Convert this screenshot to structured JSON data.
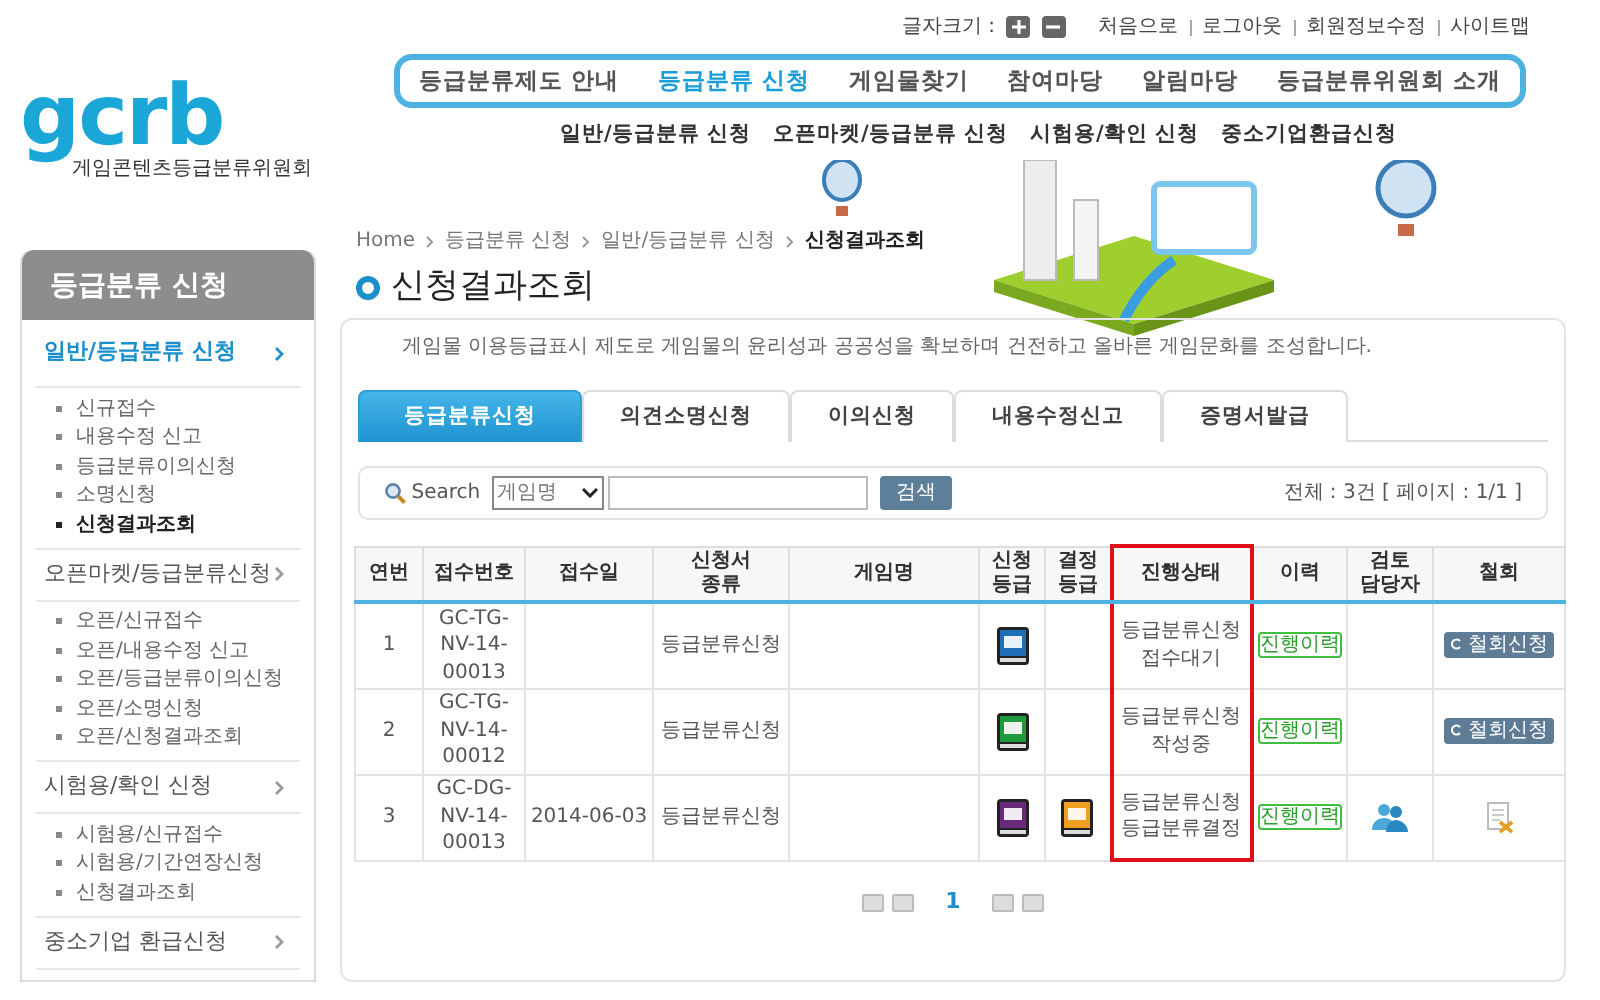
{
  "top_bar": {
    "font_size_label": "글자크기 :",
    "links": [
      "처음으로",
      "로그아웃",
      "회원정보수정",
      "사이트맵"
    ]
  },
  "logo": {
    "mark": "gcrb",
    "subtitle": "게임콘텐츠등급분류위원회"
  },
  "main_nav": [
    {
      "label": "등급분류제도 안내",
      "selected": false
    },
    {
      "label": "등급분류 신청",
      "selected": true
    },
    {
      "label": "게임물찾기",
      "selected": false
    },
    {
      "label": "참여마당",
      "selected": false
    },
    {
      "label": "알림마당",
      "selected": false
    },
    {
      "label": "등급분류위원회 소개",
      "selected": false
    }
  ],
  "sub_nav": [
    "일반/등급분류 신청",
    "오픈마켓/등급분류 신청",
    "시험용/확인 신청",
    "중소기업환급신청"
  ],
  "sidebar": {
    "title": "등급분류 신청",
    "sections": [
      {
        "label": "일반/등급분류 신청",
        "selected": true,
        "items": [
          {
            "label": "신규접수",
            "selected": false
          },
          {
            "label": "내용수정 신고",
            "selected": false
          },
          {
            "label": "등급분류이의신청",
            "selected": false
          },
          {
            "label": "소명신청",
            "selected": false
          },
          {
            "label": "신청결과조회",
            "selected": true
          }
        ]
      },
      {
        "label": "오픈마켓/등급분류신청",
        "selected": false,
        "items": [
          {
            "label": "오픈/신규접수",
            "selected": false
          },
          {
            "label": "오픈/내용수정 신고",
            "selected": false
          },
          {
            "label": "오픈/등급분류이의신청",
            "selected": false
          },
          {
            "label": "오픈/소명신청",
            "selected": false
          },
          {
            "label": "오픈/신청결과조회",
            "selected": false
          }
        ]
      },
      {
        "label": "시험용/확인 신청",
        "selected": false,
        "items": [
          {
            "label": "시험용/신규접수",
            "selected": false
          },
          {
            "label": "시험용/기간연장신청",
            "selected": false
          },
          {
            "label": "신청결과조회",
            "selected": false
          }
        ]
      },
      {
        "label": "중소기업 환급신청",
        "selected": false
      }
    ]
  },
  "breadcrumb": [
    "Home",
    "등급분류 신청",
    "일반/등급분류 신청",
    "신청결과조회"
  ],
  "page_title": "신청결과조회",
  "intro": "게임물 이용등급표시 제도로 게임물의 윤리성과 공공성을 확보하며 건전하고 올바른 게임문화를 조성합니다.",
  "tabs": [
    {
      "label": "등급분류신청",
      "selected": true
    },
    {
      "label": "의견소명신청",
      "selected": false
    },
    {
      "label": "이의신청",
      "selected": false
    },
    {
      "label": "내용수정신고",
      "selected": false
    },
    {
      "label": "증명서발급",
      "selected": false
    }
  ],
  "search": {
    "label": "Search",
    "select": "게임명",
    "button": "검색",
    "summary": "전체 : 3건 [ 페이지 : 1/1 ]"
  },
  "table": {
    "columns": [
      {
        "label": "연번",
        "highlighted": false
      },
      {
        "label": "접수번호",
        "highlighted": false
      },
      {
        "label": "접수일",
        "highlighted": false
      },
      {
        "label": "신청서\n종류",
        "highlighted": false
      },
      {
        "label": "게임명",
        "highlighted": false
      },
      {
        "label": "신청\n등급",
        "highlighted": false
      },
      {
        "label": "결정\n등급",
        "highlighted": false
      },
      {
        "label": "진행상태",
        "highlighted": true
      },
      {
        "label": "이력",
        "highlighted": false
      },
      {
        "label": "검토\n담당자",
        "highlighted": false
      },
      {
        "label": "철회",
        "highlighted": false
      }
    ],
    "rows": [
      {
        "no": "1",
        "receipt_no": "GC-TG-\nNV-14-\n00013",
        "date": "",
        "type": "등급분류신청",
        "requested_rating": {
          "kind": "twelve"
        },
        "status": "등급분류신청\n접수대기",
        "history": "진행이력",
        "reviewer": false,
        "withdraw": {
          "kind": "button",
          "label": "철회신청"
        }
      },
      {
        "no": "2",
        "receipt_no": "GC-TG-\nNV-14-\n00012",
        "date": "",
        "type": "등급분류신청",
        "requested_rating": {
          "kind": "all"
        },
        "status": "등급분류신청\n작성중",
        "history": "진행이력",
        "reviewer": false,
        "withdraw": {
          "kind": "button",
          "label": "철회신청"
        }
      },
      {
        "no": "3",
        "receipt_no": "GC-DG-\nNV-14-\n00013",
        "date": "2014-06-03",
        "type": "등급분류신청",
        "requested_rating": {
          "kind": "test"
        },
        "decided_rating": {
          "kind": "fifteen"
        },
        "status": "등급분류신청\n등급분류결정",
        "history": "진행이력",
        "reviewer": true,
        "withdraw": {
          "kind": "icon"
        }
      }
    ]
  },
  "pagination": {
    "pages": [
      {
        "label": "1",
        "selected": true
      }
    ]
  }
}
